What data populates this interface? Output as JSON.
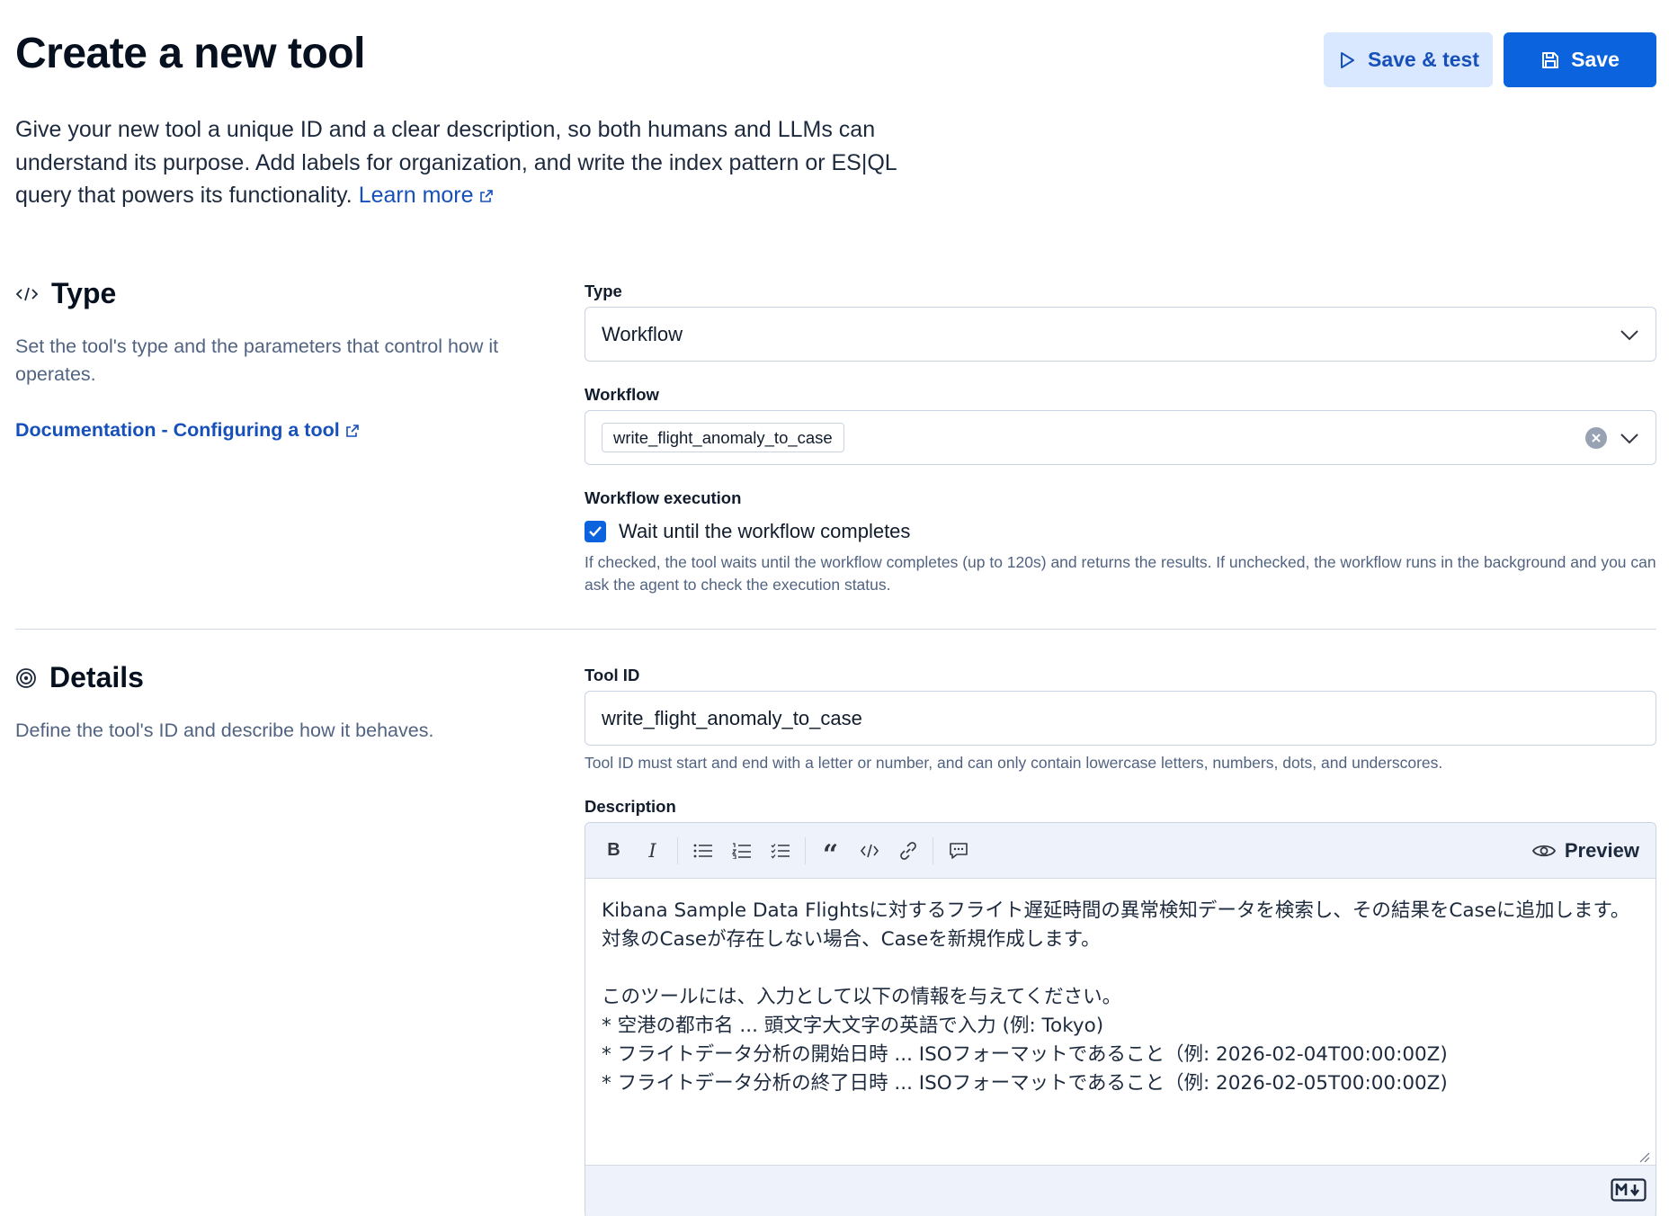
{
  "page": {
    "title": "Create a new tool",
    "intro": {
      "text_line1": "Give your new tool a unique ID and a clear description, so both humans and LLMs can",
      "text_line2": "understand its purpose. Add labels for organization, and write the index pattern or ES|QL",
      "text_line3": "query that powers its functionality.",
      "learn_more": "Learn more"
    }
  },
  "header_actions": {
    "save_test_label": "Save & test",
    "save_label": "Save"
  },
  "type_section": {
    "title": "Type",
    "description": "Set the tool's type and the parameters that control how it operates.",
    "doc_link": "Documentation - Configuring a tool",
    "type_label": "Type",
    "type_value": "Workflow",
    "workflow_label": "Workflow",
    "workflow_value": "write_flight_anomaly_to_case",
    "execution_label": "Workflow execution",
    "wait_label": "Wait until the workflow completes",
    "wait_checked": true,
    "wait_help": "If checked, the tool waits until the workflow completes (up to 120s) and returns the results. If unchecked, the workflow runs in the background and you can ask the agent to check the execution status."
  },
  "details_section": {
    "title": "Details",
    "description": "Define the tool's ID and describe how it behaves.",
    "tool_id_label": "Tool ID",
    "tool_id_value": "write_flight_anomaly_to_case",
    "tool_id_help": "Tool ID must start and end with a letter or number, and can only contain lowercase letters, numbers, dots, and underscores.",
    "description_label": "Description",
    "preview_label": "Preview",
    "description_value": "Kibana Sample Data Flightsに対するフライト遅延時間の異常検知データを検索し、その結果をCaseに追加します。対象のCaseが存在しない場合、Caseを新規作成します。\n\nこのツールには、入力として以下の情報を与えてください。\n* 空港の都市名 ... 頭文字大文字の英語で入力 (例: Tokyo)\n* フライトデータ分析の開始日時 ... ISOフォーマットであること（例: 2026-02-04T00:00:00Z)\n* フライトデータ分析の終了日時 ... ISOフォーマットであること（例: 2026-02-05T00:00:00Z)"
  },
  "icons": {
    "play": "play-icon",
    "save": "save-icon",
    "code": "code-icon",
    "target": "target-icon",
    "external": "external-link-icon"
  },
  "colors": {
    "primary": "#0b64dd",
    "link": "#1750ba",
    "secondary_bg": "#d9e8ff",
    "toolbar_bg": "#eef2fa"
  }
}
